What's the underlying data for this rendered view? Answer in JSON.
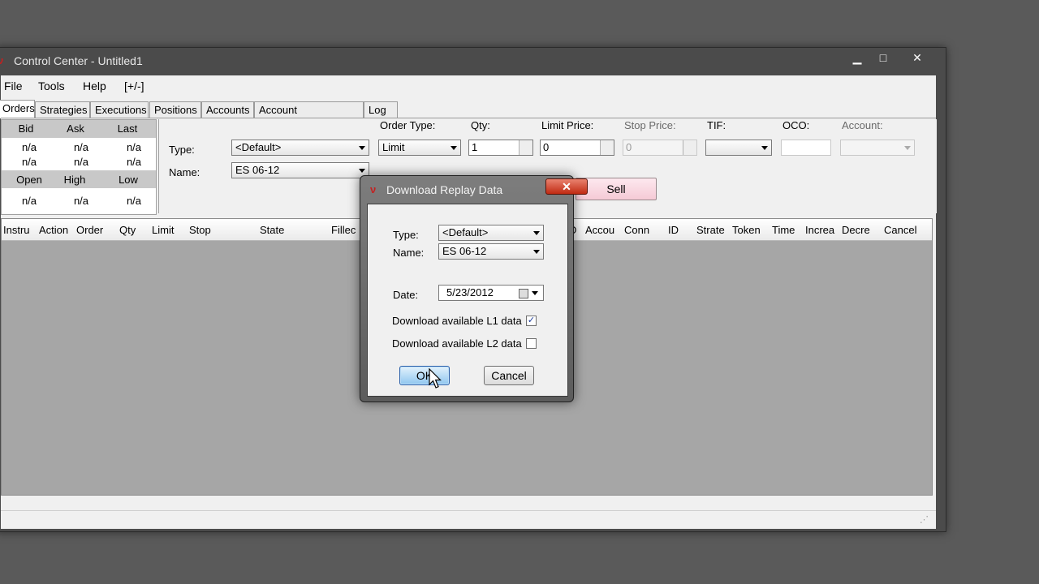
{
  "window": {
    "title": "Control Center - Untitled1"
  },
  "menu": [
    {
      "label": "File"
    },
    {
      "label": "Tools"
    },
    {
      "label": "Help"
    },
    {
      "label": "[+/-]"
    }
  ],
  "tabs": [
    {
      "label": "Orders"
    },
    {
      "label": "Strategies"
    },
    {
      "label": "Executions"
    },
    {
      "label": "Positions"
    },
    {
      "label": "Accounts"
    },
    {
      "label": "Account Performance"
    },
    {
      "label": "Log"
    }
  ],
  "market": {
    "headers1": [
      "Bid",
      "Ask",
      "Last"
    ],
    "row1": [
      "n/a",
      "n/a",
      "n/a"
    ],
    "row2": [
      "n/a",
      "n/a",
      "n/a"
    ],
    "headers2": [
      "Open",
      "High",
      "Low"
    ],
    "row3": [
      "n/a",
      "n/a",
      "n/a"
    ]
  },
  "order": {
    "type_label": "Type:",
    "type_value": "<Default>",
    "name_label": "Name:",
    "name_value": "ES 06-12",
    "order_type_label": "Order Type:",
    "order_type_value": "Limit",
    "qty_label": "Qty:",
    "qty_value": "1",
    "limit_label": "Limit Price:",
    "limit_value": "0",
    "stop_label": "Stop Price:",
    "stop_value": "0",
    "tif_label": "TIF:",
    "oco_label": "OCO:",
    "account_label": "Account:",
    "sell_label": "Sell"
  },
  "table_headers": [
    "Instru",
    "Action",
    "Order",
    "Qty",
    "Limit",
    "Stop",
    "State",
    "Fillec",
    "D",
    "Accou",
    "Conn",
    "ID",
    "Strate",
    "Token",
    "Time",
    "Increa",
    "Decre",
    "Cancel"
  ],
  "dialog": {
    "title": "Download Replay Data",
    "close": "✕",
    "type_label": "Type:",
    "type_value": "<Default>",
    "name_label": "Name:",
    "name_value": "ES 06-12",
    "date_label": "Date:",
    "date_value": "5/23/2012",
    "l1_label": "Download available L1 data",
    "l1_checked": "✓",
    "l2_label": "Download available L2 data",
    "ok": "OK",
    "cancel": "Cancel"
  }
}
